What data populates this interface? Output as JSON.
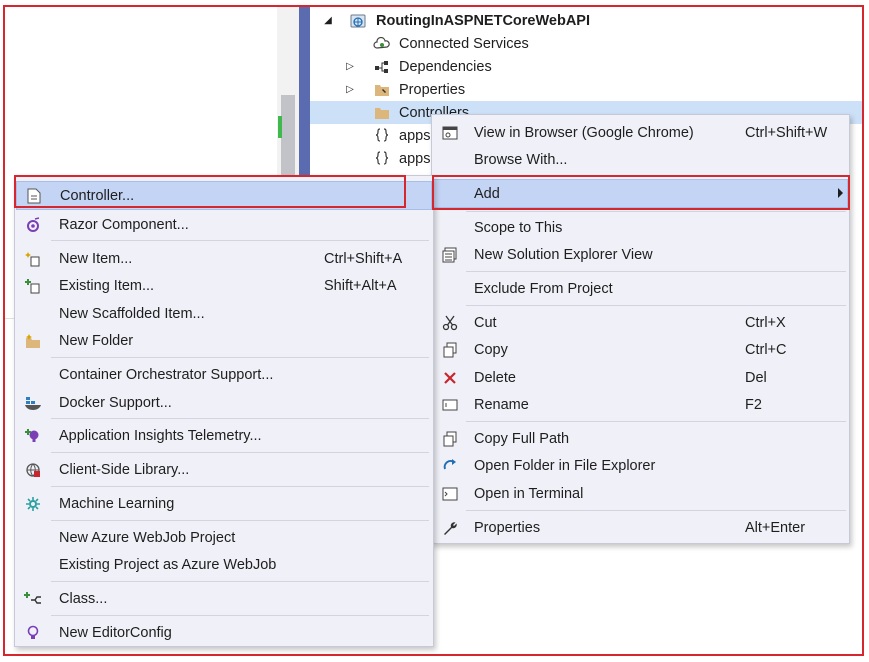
{
  "solution_explorer": {
    "project": {
      "label": "RoutingInASPNETCoreWebAPI",
      "icon": "web-project-icon"
    },
    "items": [
      {
        "label": "Connected Services",
        "icon": "connected-services-icon"
      },
      {
        "label": "Dependencies",
        "icon": "dependencies-icon"
      },
      {
        "label": "Properties",
        "icon": "properties-folder-icon"
      },
      {
        "label": "Controllers",
        "icon": "folder-icon"
      },
      {
        "label": "apps",
        "icon": "json-file-icon"
      },
      {
        "label": "apps",
        "icon": "json-file-icon"
      }
    ]
  },
  "context_menu": {
    "items": [
      {
        "label": "View in Browser (Google Chrome)",
        "shortcut": "Ctrl+Shift+W",
        "icon": "view-in-browser-icon"
      },
      {
        "label": "Browse With...",
        "shortcut": "",
        "icon": ""
      },
      {
        "label": "Add",
        "shortcut": "",
        "icon": "",
        "has_submenu": true,
        "highlighted": true
      },
      {
        "label": "Scope to This",
        "shortcut": "",
        "icon": ""
      },
      {
        "label": "New Solution Explorer View",
        "shortcut": "",
        "icon": "new-explorer-view-icon"
      },
      {
        "label": "Exclude From Project",
        "shortcut": "",
        "icon": ""
      },
      {
        "label": "Cut",
        "shortcut": "Ctrl+X",
        "icon": "cut-icon"
      },
      {
        "label": "Copy",
        "shortcut": "Ctrl+C",
        "icon": "copy-icon"
      },
      {
        "label": "Delete",
        "shortcut": "Del",
        "icon": "delete-icon"
      },
      {
        "label": "Rename",
        "shortcut": "F2",
        "icon": "rename-icon"
      },
      {
        "label": "Copy Full Path",
        "shortcut": "",
        "icon": "copy-path-icon"
      },
      {
        "label": "Open Folder in File Explorer",
        "shortcut": "",
        "icon": "open-folder-icon"
      },
      {
        "label": "Open in Terminal",
        "shortcut": "",
        "icon": "terminal-icon"
      },
      {
        "label": "Properties",
        "shortcut": "Alt+Enter",
        "icon": "wrench-icon"
      }
    ]
  },
  "add_submenu": {
    "items": [
      {
        "label": "Controller...",
        "shortcut": "",
        "icon": "controller-icon",
        "highlighted": true
      },
      {
        "label": "Razor Component...",
        "shortcut": "",
        "icon": "razor-icon"
      },
      {
        "label": "New Item...",
        "shortcut": "Ctrl+Shift+A",
        "icon": "new-item-icon"
      },
      {
        "label": "Existing Item...",
        "shortcut": "Shift+Alt+A",
        "icon": "existing-item-icon"
      },
      {
        "label": "New Scaffolded Item...",
        "shortcut": "",
        "icon": ""
      },
      {
        "label": "New Folder",
        "shortcut": "",
        "icon": "new-folder-icon"
      },
      {
        "label": "Container Orchestrator Support...",
        "shortcut": "",
        "icon": ""
      },
      {
        "label": "Docker Support...",
        "shortcut": "",
        "icon": "docker-icon"
      },
      {
        "label": "Application Insights Telemetry...",
        "shortcut": "",
        "icon": "app-insights-icon"
      },
      {
        "label": "Client-Side Library...",
        "shortcut": "",
        "icon": "client-library-icon"
      },
      {
        "label": "Machine Learning",
        "shortcut": "",
        "icon": "machine-learning-icon"
      },
      {
        "label": "New Azure WebJob Project",
        "shortcut": "",
        "icon": ""
      },
      {
        "label": "Existing Project as Azure WebJob",
        "shortcut": "",
        "icon": ""
      },
      {
        "label": "Class...",
        "shortcut": "",
        "icon": "class-icon"
      },
      {
        "label": "New EditorConfig",
        "shortcut": "",
        "icon": "editorconfig-icon"
      }
    ]
  },
  "colors": {
    "highlight": "#c4d4f4",
    "menu_background": "#f0f1f8",
    "annotation_red": "#d6262e",
    "selection": "#cce0f7"
  }
}
